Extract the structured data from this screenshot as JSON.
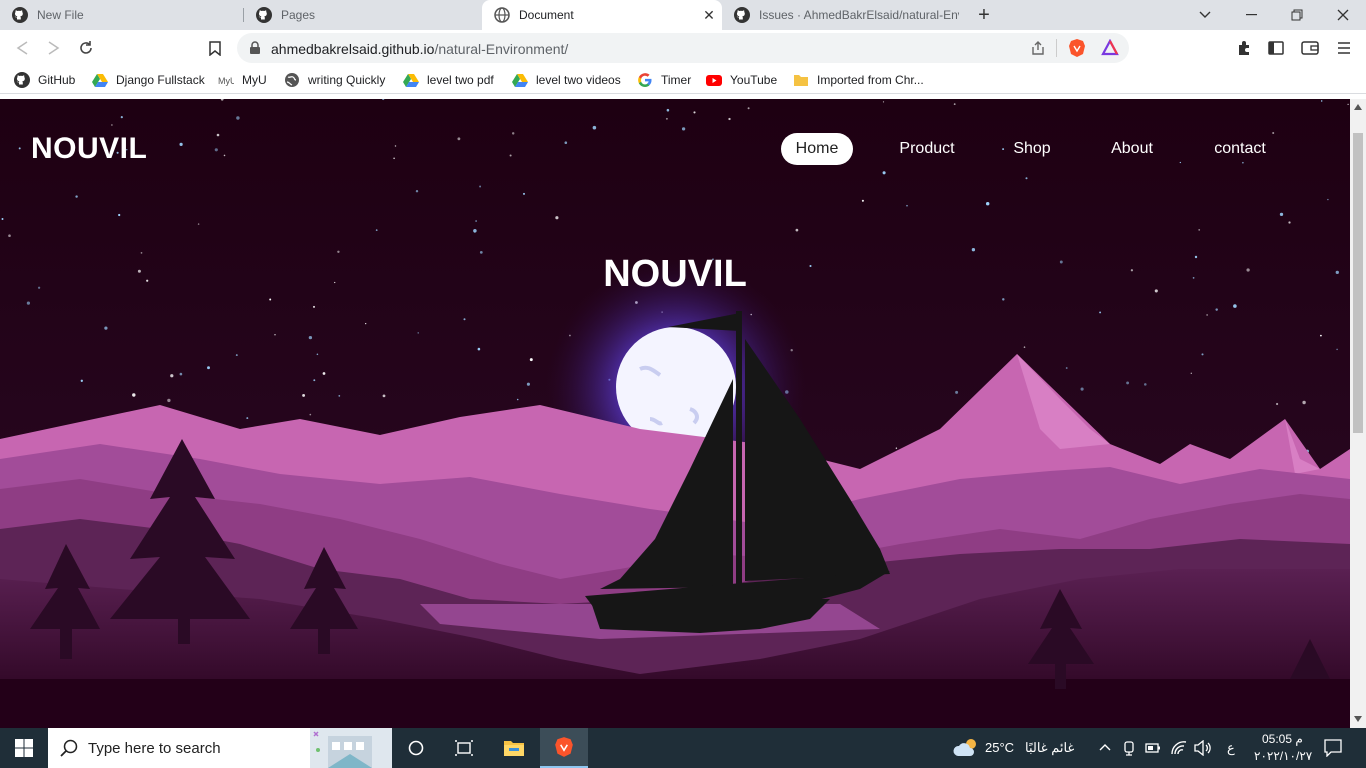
{
  "browser": {
    "tabs": [
      {
        "title": "New File",
        "icon": "github-icon",
        "active": false
      },
      {
        "title": "Pages",
        "icon": "github-icon",
        "active": false
      },
      {
        "title": "Document",
        "icon": "globe-icon",
        "active": true
      },
      {
        "title": "Issues · AhmedBakrElsaid/natural-Env",
        "icon": "github-icon",
        "active": false
      }
    ],
    "address": {
      "host": "ahmedbakrelsaid.github.io",
      "path": "/natural-Environment/"
    },
    "bookmarks": [
      {
        "label": "GitHub",
        "icon": "github-icon"
      },
      {
        "label": "Django Fullstack",
        "icon": "google-drive-icon"
      },
      {
        "label": "MyU",
        "icon": "myu-icon"
      },
      {
        "label": "writing Quickly",
        "icon": "globe-icon"
      },
      {
        "label": "level two pdf",
        "icon": "google-drive-icon"
      },
      {
        "label": "level two videos",
        "icon": "google-drive-icon"
      },
      {
        "label": "Timer",
        "icon": "google-icon"
      },
      {
        "label": "YouTube",
        "icon": "youtube-icon"
      },
      {
        "label": "Imported from Chr...",
        "icon": "folder-icon"
      }
    ]
  },
  "page": {
    "brand": "NOUVIL",
    "nav": [
      {
        "label": "Home",
        "active": true
      },
      {
        "label": "Product",
        "active": false
      },
      {
        "label": "Shop",
        "active": false
      },
      {
        "label": "About",
        "active": false
      },
      {
        "label": "contact",
        "active": false
      }
    ],
    "hero_title": "NOUVIL",
    "colors": {
      "sky": "#220015",
      "mountain_light": "#c766b1",
      "mountain_mid": "#8f3d84",
      "mountain_dark": "#5d2456",
      "ground": "#3a0f33",
      "moon": "#f3f3ff",
      "moon_glow": "#6a4ad8",
      "boat": "#161616"
    }
  },
  "taskbar": {
    "search_placeholder": "Type here to search",
    "weather_temp": "25°C",
    "weather_desc": "غائم غالبًا",
    "lang": "ع",
    "time": "05:05 م",
    "date": "٢٠٢٢/١٠/٢٧"
  }
}
